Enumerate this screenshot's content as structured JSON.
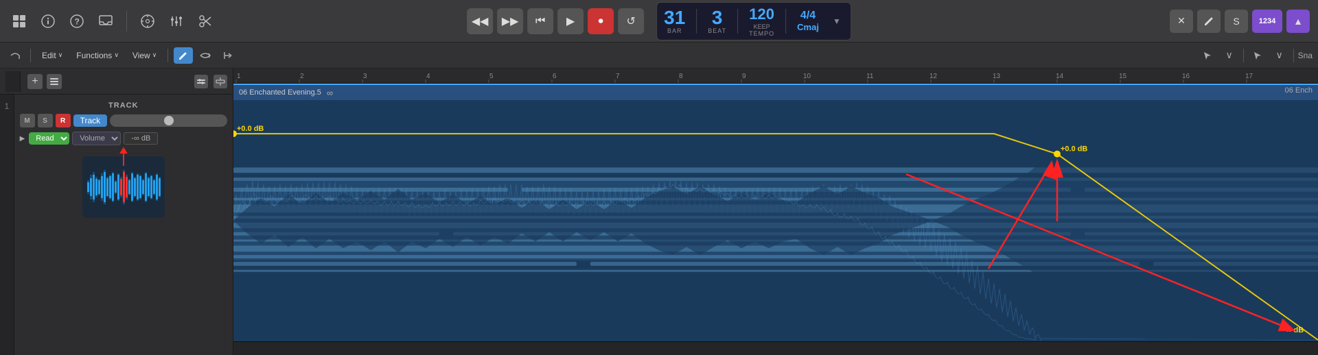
{
  "toolbar": {
    "icons": {
      "grid": "⊞",
      "info": "ⓘ",
      "help": "?",
      "inbox": "📥",
      "metronome": "♩",
      "mixer": "⊟",
      "scissors": "✂"
    },
    "transport": {
      "rewind": "⏮",
      "rewind_label": "◀◀",
      "fast_forward_label": "▶▶",
      "skip_back_label": "⏮",
      "play_label": "▶",
      "record_label": "⏺",
      "cycle_label": "↺"
    },
    "display": {
      "bar": "31",
      "bar_label": "BAR",
      "beat": "3",
      "beat_label": "BEAT",
      "tempo": "120",
      "tempo_keep": "KEEP",
      "tempo_label": "TEMPO",
      "time_sig": "4/4",
      "key": "Cmaj",
      "dropdown": "▼"
    },
    "right_buttons": {
      "close": "✕",
      "pencil": "✏",
      "s_btn": "S",
      "number": "1234",
      "triangle": "▲"
    }
  },
  "second_toolbar": {
    "edit_label": "Edit",
    "functions_label": "Functions",
    "view_label": "View",
    "chevron": "∨",
    "pencil_icon": "✏",
    "loop_icon": "⇄",
    "snap_icon": "|←",
    "pointer_icon": "↖",
    "pointer2_icon": "↘",
    "snap_label": "Sna"
  },
  "left_panel": {
    "add_label": "+",
    "icon2": "⊟",
    "icon3": "▼",
    "track_label": "TRACK",
    "mute": "M",
    "solo": "S",
    "rec": "R",
    "track_btn": "Track",
    "read_label": "Read",
    "volume_label": "Volume",
    "db_value": "-∞ dB",
    "track_number": "1"
  },
  "ruler": {
    "marks": [
      1,
      2,
      3,
      4,
      5,
      6,
      7,
      8,
      9,
      10,
      11,
      12,
      13,
      14,
      15,
      16,
      17
    ]
  },
  "region": {
    "title": "06 Enchanted Evening.5",
    "title_right": "06 Ench",
    "loop_sym": "∞",
    "db_left": "+0.0 dB",
    "db_right": "+0.0 dB",
    "db_far_right": "-∞ dB"
  },
  "colors": {
    "accent_blue": "#4af",
    "track_header_bg": "#2a5080",
    "record_red": "#cc3333",
    "green": "#44aa44",
    "purple": "#7c4dcc",
    "automation_yellow": "#ffd700",
    "arrow_red": "#ff2222"
  }
}
